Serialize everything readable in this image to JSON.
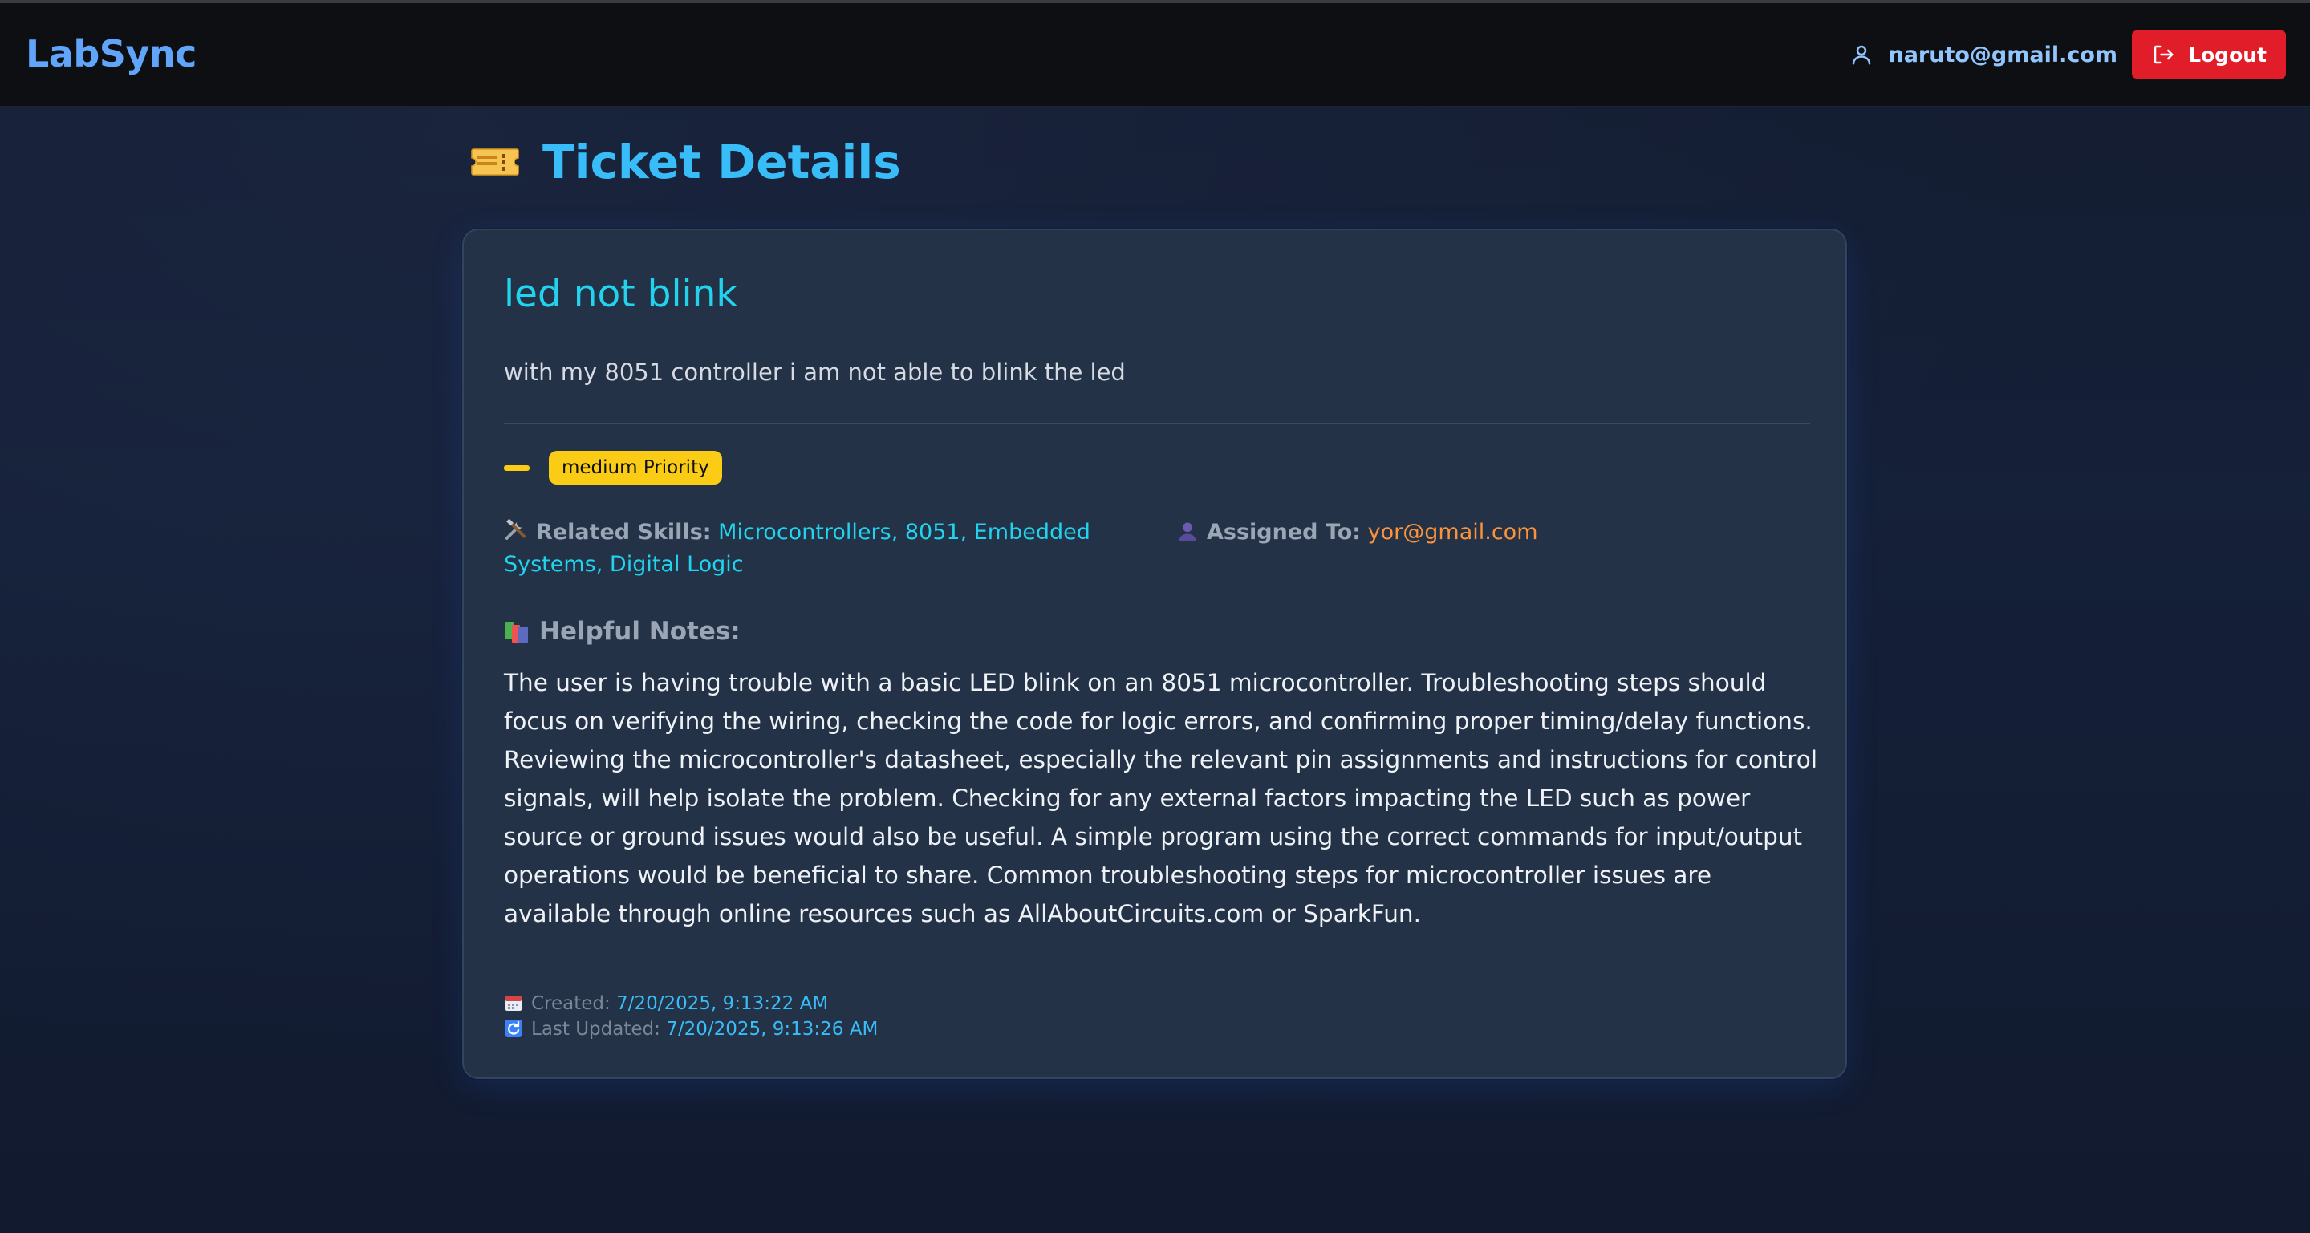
{
  "app": {
    "brand": "LabSync"
  },
  "navbar": {
    "user_email": "naruto@gmail.com",
    "logout_label": "Logout"
  },
  "page": {
    "title": "Ticket Details"
  },
  "ticket": {
    "title": "led not blink",
    "description": "with my 8051 controller i am not able to blink the led",
    "priority_badge": "medium Priority",
    "priority_color": "#facc15",
    "related_skills_label": "Related Skills:",
    "related_skills": "Microcontrollers, 8051, Embedded Systems, Digital Logic",
    "assigned_label": "Assigned To:",
    "assigned_to": "yor@gmail.com",
    "notes_label": "Helpful Notes:",
    "notes": "The user is having trouble with a basic LED blink on an 8051 microcontroller. Troubleshooting steps should focus on verifying the wiring, checking the code for logic errors, and confirming proper timing/delay functions. Reviewing the microcontroller's datasheet, especially the relevant pin assignments and instructions for control signals, will help isolate the problem. Checking for any external factors impacting the LED such as power source or ground issues would also be useful. A simple program using the correct commands for input/output operations would be beneficial to share. Common troubleshooting steps for microcontroller issues are available through online resources such as AllAboutCircuits.com or SparkFun.",
    "created_label": "Created:",
    "created": "7/20/2025, 9:13:22 AM",
    "updated_label": "Last Updated:",
    "updated": "7/20/2025, 9:13:26 AM"
  },
  "icons": {
    "user": "user-icon",
    "logout": "logout-icon",
    "ticket": "ticket-icon",
    "skills": "tools-icon",
    "assigned": "person-icon",
    "notes": "books-icon",
    "created": "calendar-icon",
    "updated": "refresh-icon"
  },
  "colors": {
    "brand": "#60a5fa",
    "accent": "#38bdf8",
    "title": "#22d3ee",
    "logout_bg": "#e11d2a",
    "assigned": "#fb923c"
  }
}
